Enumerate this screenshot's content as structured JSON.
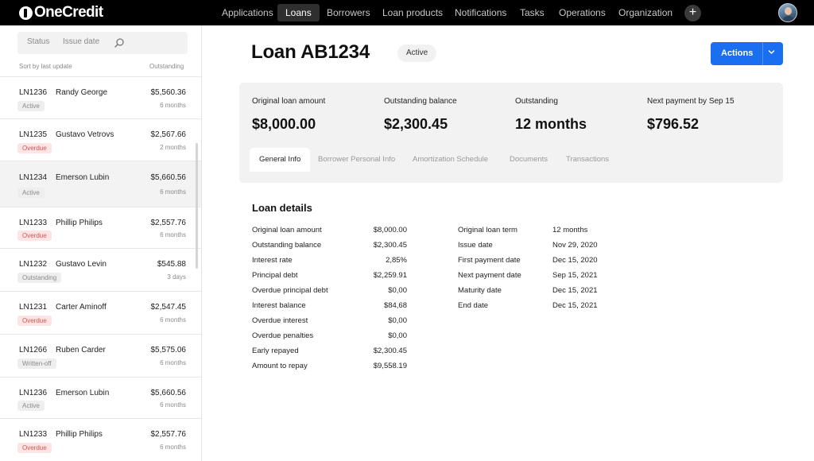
{
  "app": {
    "name": "OneCredit"
  },
  "nav": {
    "items": [
      "Applications",
      "Loans",
      "Borrowers",
      "Loan products",
      "Notifications",
      "Tasks",
      "Operations",
      "Organization"
    ],
    "active": "Loans",
    "add_label": "+"
  },
  "sidebar": {
    "filters": {
      "status": "Status",
      "issue_date": "Issue date"
    },
    "sort_label": "Sort by last update",
    "outstanding_header": "Outstanding",
    "loans": [
      {
        "id": "LN1236",
        "name": "Randy George",
        "amount": "$5,560.36",
        "status": "Active",
        "duration": "6 months"
      },
      {
        "id": "LN1235",
        "name": "Gustavo Vetrovs",
        "amount": "$2,567.66",
        "status": "Overdue",
        "duration": "2 months"
      },
      {
        "id": "LN1234",
        "name": "Emerson Lubin",
        "amount": "$5,660.56",
        "status": "Active",
        "duration": "6 months"
      },
      {
        "id": "LN1233",
        "name": "Phillip Philips",
        "amount": "$2,557.76",
        "status": "Overdue",
        "duration": "6 months"
      },
      {
        "id": "LN1232",
        "name": "Gustavo Levin",
        "amount": "$545.88",
        "status": "Outstanding",
        "duration": "3 days"
      },
      {
        "id": "LN1231",
        "name": "Carter Aminoff",
        "amount": "$2,547.45",
        "status": "Overdue",
        "duration": "6 months"
      },
      {
        "id": "LN1266",
        "name": "Ruben Carder",
        "amount": "$5,575.06",
        "status": "Written-off",
        "duration": "6 months"
      },
      {
        "id": "LN1236",
        "name": "Emerson Lubin",
        "amount": "$5,660.56",
        "status": "Active",
        "duration": "6 months"
      },
      {
        "id": "LN1233",
        "name": "Phillip Philips",
        "amount": "$2,557.76",
        "status": "Overdue",
        "duration": "6 months"
      }
    ]
  },
  "loan": {
    "title": "Loan AB1234",
    "status": "Active",
    "actions_label": "Actions",
    "summary": [
      {
        "label": "Original loan amount",
        "value": "$8,000.00"
      },
      {
        "label": "Outstanding balance",
        "value": "$2,300.45"
      },
      {
        "label": "Outstanding",
        "value": "12 months"
      },
      {
        "label": "Next payment by Sep 15",
        "value": "$796.52"
      }
    ],
    "tabs": [
      "General Info",
      "Borrower Personal Info",
      "Amortization Schedule",
      "Documents",
      "Transactions"
    ],
    "active_tab": "General Info",
    "details_title": "Loan details",
    "details_left": [
      {
        "label": "Original loan amount",
        "value": "$8,000.00"
      },
      {
        "label": "Outstanding balance",
        "value": "$2,300.45"
      },
      {
        "label": "Interest rate",
        "value": "2,85%"
      },
      {
        "label": "Principal debt",
        "value": "$2,259.91"
      },
      {
        "label": "Overdue principal debt",
        "value": "$0,00"
      },
      {
        "label": "Interest balance",
        "value": "$84,68"
      },
      {
        "label": "Overdue interest",
        "value": "$0,00"
      },
      {
        "label": "Overdue penalties",
        "value": "$0,00"
      },
      {
        "label": "Early repayed",
        "value": "$2,300.45"
      },
      {
        "label": "Amount to repay",
        "value": "$9,558.19"
      }
    ],
    "details_right": [
      {
        "label": "Original loan term",
        "value": "12 months"
      },
      {
        "label": "Issue date",
        "value": "Nov 29, 2020"
      },
      {
        "label": "First payment date",
        "value": "Dec 15, 2020"
      },
      {
        "label": "Next payment date",
        "value": "Sep 15, 2021"
      },
      {
        "label": "Maturity date",
        "value": "Dec 15, 2021"
      },
      {
        "label": "End date",
        "value": "Dec 15, 2021"
      }
    ]
  },
  "colors": {
    "topbar": "#000000",
    "accent": "#1a6ff0",
    "overdue_text": "#d9534f",
    "overdue_bg": "#fde5e5",
    "card_bg": "#f2f2f2"
  },
  "icons": {
    "search": "search-icon",
    "actions_dropdown": "chevron-down-icon",
    "add": "plus-icon",
    "user": "avatar"
  }
}
